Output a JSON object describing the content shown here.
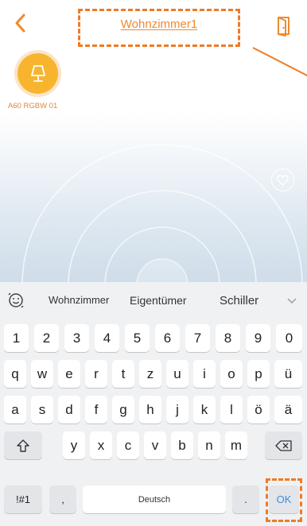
{
  "header": {
    "title": "Wohnzimmer1"
  },
  "device": {
    "label": "A60 RGBW 01",
    "icon": "lamp-icon"
  },
  "colors": {
    "accent": "#ee8a2e",
    "device_bg": "#f7b52f",
    "highlight": "#ee7b24",
    "ok_text": "#3a8ee6"
  },
  "keyboard": {
    "suggestions": [
      "Wohnzimmer",
      "Eigentümer",
      "Schiller"
    ],
    "rows": [
      [
        "1",
        "2",
        "3",
        "4",
        "5",
        "6",
        "7",
        "8",
        "9",
        "0"
      ],
      [
        "q",
        "w",
        "e",
        "r",
        "t",
        "z",
        "u",
        "i",
        "o",
        "p",
        "ü"
      ],
      [
        "a",
        "s",
        "d",
        "f",
        "g",
        "h",
        "j",
        "k",
        "l",
        "ö",
        "ä"
      ],
      [
        "y",
        "x",
        "c",
        "v",
        "b",
        "n",
        "m"
      ]
    ],
    "symbols_label": "!#1",
    "comma_label": ",",
    "space_label": "Deutsch",
    "period_label": ".",
    "ok_label": "OK"
  }
}
